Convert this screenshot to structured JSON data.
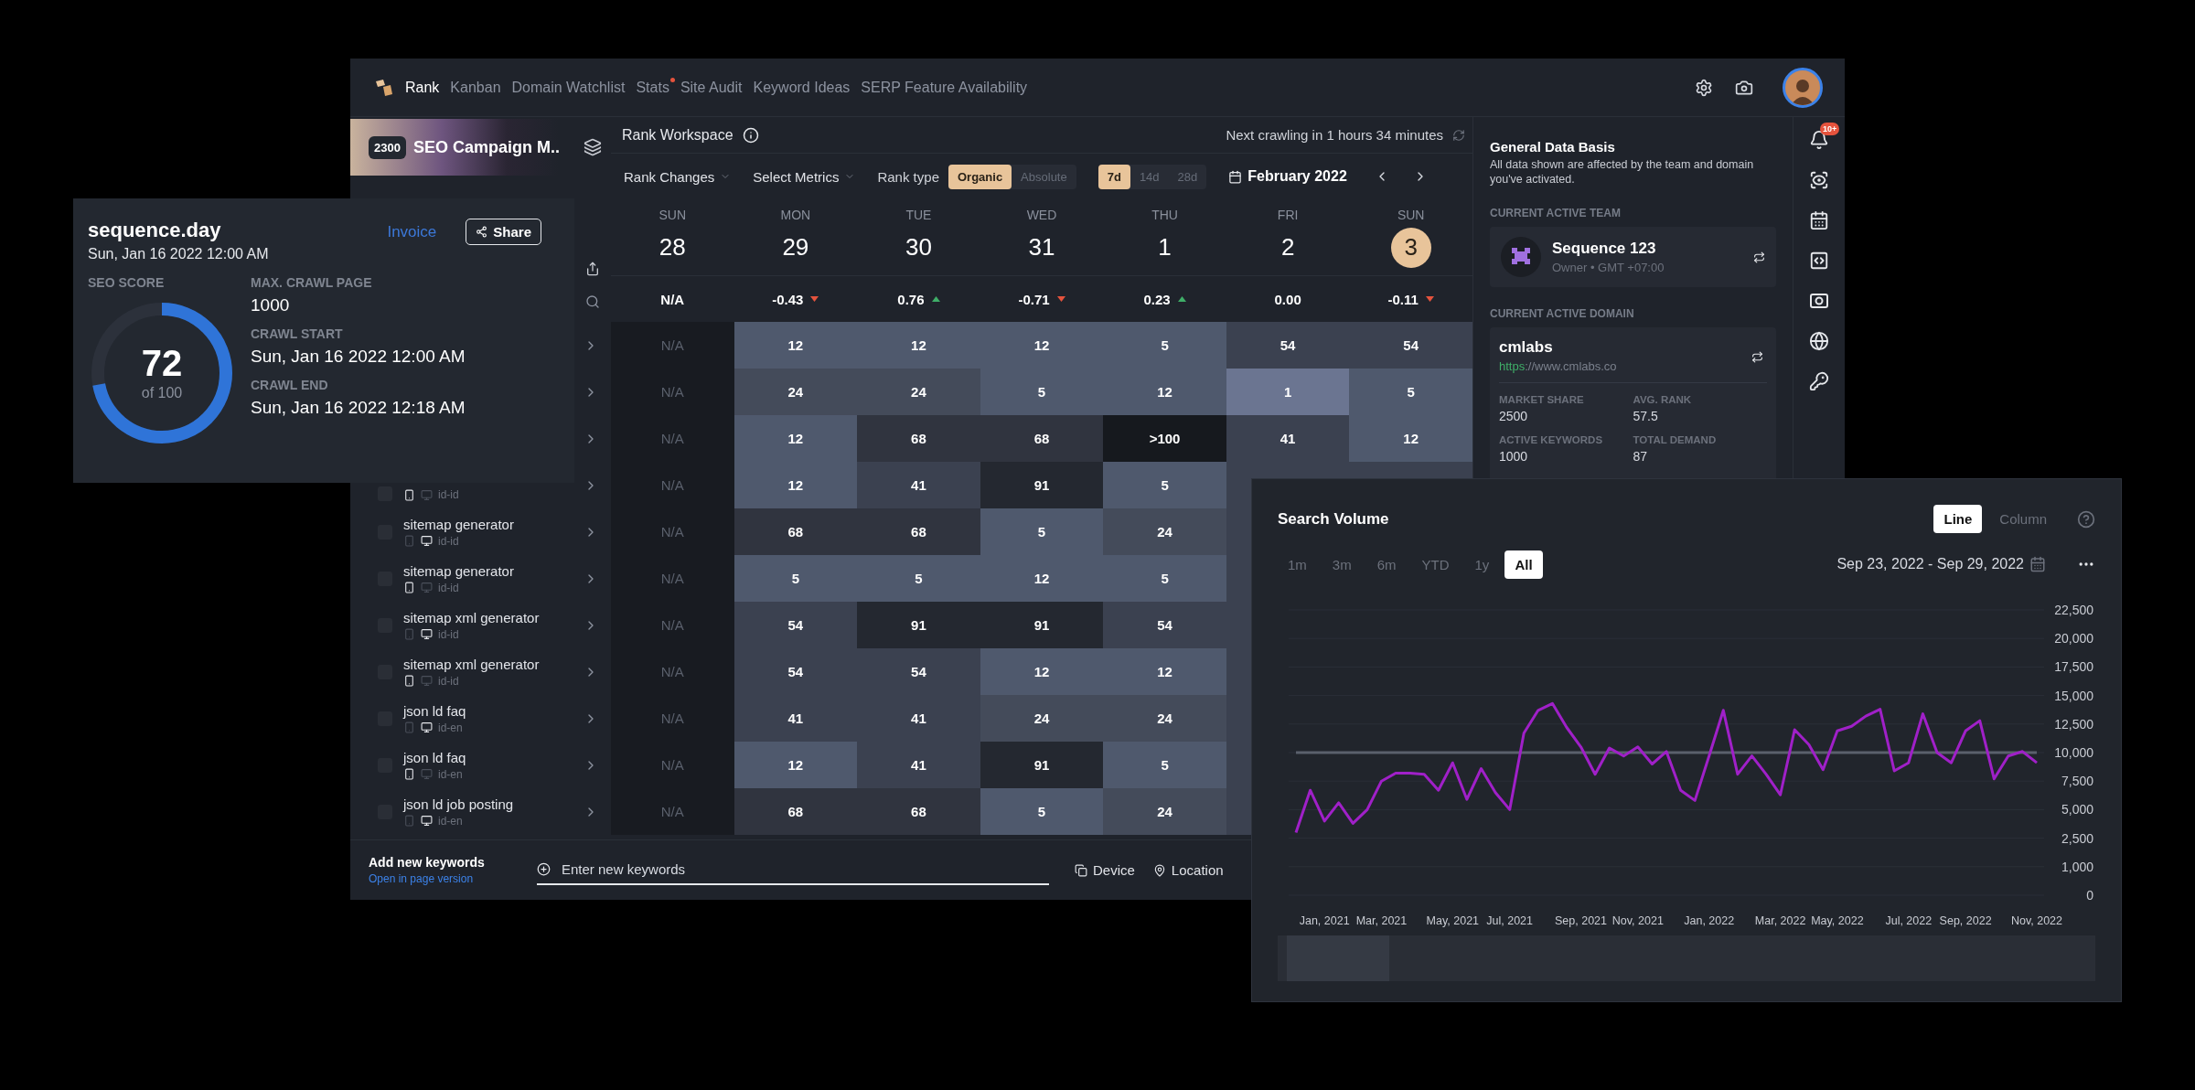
{
  "nav": {
    "items": [
      {
        "label": "Rank",
        "selected": true,
        "dot": false
      },
      {
        "label": "Kanban",
        "selected": false,
        "dot": false
      },
      {
        "label": "Domain Watchlist",
        "selected": false,
        "dot": false
      },
      {
        "label": "Stats",
        "selected": false,
        "dot": true
      },
      {
        "label": "Site Audit",
        "selected": false,
        "dot": false
      },
      {
        "label": "Keyword Ideas",
        "selected": false,
        "dot": false
      },
      {
        "label": "SERP Feature Availability",
        "selected": false,
        "dot": false
      }
    ]
  },
  "sidebar": {
    "count": "2300",
    "campaign": "SEO Campaign M..",
    "rows": [
      {
        "kind": "covered"
      },
      {
        "kind": "covered"
      },
      {
        "kind": "covered"
      },
      {
        "kind": "partial",
        "locale": "id-id",
        "mobile_active": true,
        "checked": false
      },
      {
        "kind": "keyword",
        "title": "sitemap generator",
        "locale": "id-id",
        "mobile_active": false,
        "checked": false
      },
      {
        "kind": "keyword",
        "title": "sitemap generator",
        "locale": "id-id",
        "mobile_active": true,
        "checked": false
      },
      {
        "kind": "keyword",
        "title": "sitemap xml generator",
        "locale": "id-id",
        "mobile_active": false,
        "checked": false
      },
      {
        "kind": "keyword",
        "title": "sitemap xml generator",
        "locale": "id-id",
        "mobile_active": true,
        "checked": false
      },
      {
        "kind": "keyword",
        "title": "json ld faq",
        "locale": "id-en",
        "mobile_active": false,
        "checked": false
      },
      {
        "kind": "keyword",
        "title": "json ld faq",
        "locale": "id-en",
        "mobile_active": true,
        "checked": false
      },
      {
        "kind": "keyword",
        "title": "json ld job posting",
        "locale": "id-en",
        "mobile_active": false,
        "checked": false
      }
    ]
  },
  "workspace": {
    "title": "Rank Workspace",
    "next_crawl": "Next crawling in 1 hours 34 minutes",
    "filters": [
      "Rank Changes",
      "Select Metrics"
    ],
    "rank_type_label": "Rank type",
    "rank_types": [
      {
        "label": "Organic",
        "selected": true
      },
      {
        "label": "Absolute",
        "selected": false
      }
    ],
    "periods": [
      {
        "label": "7d",
        "selected": true
      },
      {
        "label": "14d",
        "selected": false
      },
      {
        "label": "28d",
        "selected": false
      }
    ],
    "month": "February 2022"
  },
  "days": [
    {
      "weekday": "SUN",
      "date": "28",
      "selected": false,
      "change": "N/A",
      "kind": "flat"
    },
    {
      "weekday": "MON",
      "date": "29",
      "selected": false,
      "change": "-0.43",
      "kind": "down"
    },
    {
      "weekday": "TUE",
      "date": "30",
      "selected": false,
      "change": "0.76",
      "kind": "up"
    },
    {
      "weekday": "WED",
      "date": "31",
      "selected": false,
      "change": "-0.71",
      "kind": "down"
    },
    {
      "weekday": "THU",
      "date": "1",
      "selected": false,
      "change": "0.23",
      "kind": "up"
    },
    {
      "weekday": "FRI",
      "date": "2",
      "selected": false,
      "change": "0.00",
      "kind": "flat"
    },
    {
      "weekday": "SUN",
      "date": "3",
      "selected": true,
      "change": "-0.11",
      "kind": "down"
    }
  ],
  "grid": {
    "rows": [
      [
        {
          "value": "N/A",
          "color": "#181b21"
        },
        {
          "value": "12",
          "color": "#4f596d"
        },
        {
          "value": "12",
          "color": "#4f596d"
        },
        {
          "value": "12",
          "color": "#4f596d"
        },
        {
          "value": "5",
          "color": "#4f596d"
        },
        {
          "value": "54",
          "color": "#3b4150"
        },
        {
          "value": "54",
          "color": "#3b4150"
        }
      ],
      [
        {
          "value": "N/A",
          "color": "#181b21"
        },
        {
          "value": "24",
          "color": "#444b5a"
        },
        {
          "value": "24",
          "color": "#444b5a"
        },
        {
          "value": "5",
          "color": "#4f596d"
        },
        {
          "value": "12",
          "color": "#4f596d"
        },
        {
          "value": "1",
          "color": "#6b7591"
        },
        {
          "value": "5",
          "color": "#4f596d"
        }
      ],
      [
        {
          "value": "N/A",
          "color": "#181b21"
        },
        {
          "value": "12",
          "color": "#4f596d"
        },
        {
          "value": "68",
          "color": "#30343f"
        },
        {
          "value": "68",
          "color": "#30343f"
        },
        {
          "value": ">100",
          "color": "#16191e"
        },
        {
          "value": "41",
          "color": "#3b4150"
        },
        {
          "value": "12",
          "color": "#4f596d"
        }
      ],
      [
        {
          "value": "N/A",
          "color": "#181b21"
        },
        {
          "value": "12",
          "color": "#4f596d"
        },
        {
          "value": "41",
          "color": "#3b4150"
        },
        {
          "value": "91",
          "color": "#242830"
        },
        {
          "value": "5",
          "color": "#4f596d"
        }
      ],
      [
        {
          "value": "N/A",
          "color": "#181b21"
        },
        {
          "value": "68",
          "color": "#30343f"
        },
        {
          "value": "68",
          "color": "#30343f"
        },
        {
          "value": "5",
          "color": "#4f596d"
        },
        {
          "value": "24",
          "color": "#444b5a"
        }
      ],
      [
        {
          "value": "N/A",
          "color": "#181b21"
        },
        {
          "value": "5",
          "color": "#4f596d"
        },
        {
          "value": "5",
          "color": "#4f596d"
        },
        {
          "value": "12",
          "color": "#4f596d"
        },
        {
          "value": "5",
          "color": "#4f596d"
        }
      ],
      [
        {
          "value": "N/A",
          "color": "#181b21"
        },
        {
          "value": "54",
          "color": "#3b4150"
        },
        {
          "value": "91",
          "color": "#242830"
        },
        {
          "value": "91",
          "color": "#242830"
        },
        {
          "value": "54",
          "color": "#3b4150"
        }
      ],
      [
        {
          "value": "N/A",
          "color": "#181b21"
        },
        {
          "value": "54",
          "color": "#3b4150"
        },
        {
          "value": "54",
          "color": "#3b4150"
        },
        {
          "value": "12",
          "color": "#4f596d"
        },
        {
          "value": "12",
          "color": "#4f596d"
        }
      ],
      [
        {
          "value": "N/A",
          "color": "#181b21"
        },
        {
          "value": "41",
          "color": "#3b4150"
        },
        {
          "value": "41",
          "color": "#3b4150"
        },
        {
          "value": "24",
          "color": "#444b5a"
        },
        {
          "value": "24",
          "color": "#444b5a"
        }
      ],
      [
        {
          "value": "N/A",
          "color": "#181b21"
        },
        {
          "value": "12",
          "color": "#4f596d"
        },
        {
          "value": "41",
          "color": "#3b4150"
        },
        {
          "value": "91",
          "color": "#242830"
        },
        {
          "value": "5",
          "color": "#4f596d"
        }
      ],
      [
        {
          "value": "N/A",
          "color": "#181b21"
        },
        {
          "value": "68",
          "color": "#30343f"
        },
        {
          "value": "68",
          "color": "#30343f"
        },
        {
          "value": "5",
          "color": "#4f596d"
        },
        {
          "value": "24",
          "color": "#444b5a"
        }
      ]
    ]
  },
  "footer": {
    "title": "Add new keywords",
    "link": "Open in page version",
    "placeholder": "Enter new keywords",
    "device": "Device",
    "location": "Location"
  },
  "info": {
    "title": "General Data Basis",
    "description": "All data shown are affected by the team and domain you've activated.",
    "team_label": "CURRENT ACTIVE TEAM",
    "team_name": "Sequence 123",
    "team_meta": "Owner • GMT +07:00",
    "domain_label": "CURRENT ACTIVE DOMAIN",
    "domain_name": "cmlabs",
    "url_scheme": "https",
    "url_rest": "://www.cmlabs.co",
    "stats": [
      {
        "label": "MARKET SHARE",
        "value": "2500"
      },
      {
        "label": "AVG. RANK",
        "value": "57.5"
      },
      {
        "label": "ACTIVE KEYWORDS",
        "value": "1000"
      },
      {
        "label": "TOTAL DEMAND",
        "value": "87"
      }
    ]
  },
  "notifications": {
    "badge": "10+"
  },
  "crawl_card": {
    "site": "sequence.day",
    "date": "Sun, Jan 16 2022 12:00 AM",
    "invoice": "Invoice",
    "share": "Share",
    "score_label": "SEO SCORE",
    "score": "72",
    "score_of": "of 100",
    "level": 0.72,
    "facts": [
      {
        "label": "MAX. CRAWL PAGE",
        "value": "1000"
      },
      {
        "label": "CRAWL START",
        "value": "Sun, Jan 16 2022 12:00 AM"
      },
      {
        "label": "CRAWL END",
        "value": "Sun, Jan 16 2022 12:18 AM"
      }
    ]
  },
  "search_volume": {
    "title": "Search Volume",
    "views": [
      {
        "label": "Line",
        "selected": true
      },
      {
        "label": "Column",
        "selected": false
      }
    ],
    "ranges": [
      {
        "label": "1m",
        "selected": false
      },
      {
        "label": "3m",
        "selected": false
      },
      {
        "label": "6m",
        "selected": false
      },
      {
        "label": "YTD",
        "selected": false
      },
      {
        "label": "1y",
        "selected": false
      },
      {
        "label": "All",
        "selected": true
      }
    ],
    "date_range": "Sep 23, 2022 - Sep 29, 2022",
    "chart_data": {
      "type": "line",
      "categories": [
        null,
        null,
        "Jan, 2021",
        null,
        null,
        null,
        "Mar, 2021",
        null,
        null,
        null,
        null,
        "May, 2021",
        null,
        null,
        null,
        "Jul, 2021",
        null,
        null,
        null,
        null,
        "Sep, 2021",
        null,
        null,
        null,
        "Nov, 2021",
        null,
        null,
        null,
        null,
        "Jan, 2022",
        null,
        null,
        null,
        null,
        "Mar, 2022",
        null,
        null,
        null,
        "May, 2022",
        null,
        null,
        null,
        null,
        "Jul, 2022",
        null,
        null,
        null,
        "Sep, 2022",
        null,
        null,
        null,
        null,
        "Nov, 2022"
      ],
      "series": [
        {
          "color": "#5a606c",
          "values": [
            10000,
            10000,
            10000,
            10000,
            10000,
            10000,
            10000,
            10000,
            10000,
            10000,
            10000,
            10000,
            10000,
            10000,
            10000,
            10000,
            10000,
            10000,
            10000,
            10000,
            10000,
            10000,
            10000,
            10000,
            10000,
            10000,
            10000,
            10000,
            10000,
            10000,
            10000,
            10000,
            10000,
            10000,
            10000,
            10000,
            10000,
            10000,
            10000,
            10000,
            10000,
            10000,
            10000,
            10000,
            10000,
            10000,
            10000,
            10000,
            10000,
            10000,
            10000,
            10000,
            10000
          ]
        },
        {
          "color": "#a020c8",
          "values": [
            3000,
            6700,
            4000,
            5600,
            3800,
            5000,
            7500,
            8200,
            8200,
            8100,
            6700,
            9100,
            5900,
            8600,
            6500,
            5000,
            11700,
            13700,
            14300,
            12200,
            10500,
            8100,
            10400,
            9700,
            10500,
            9000,
            10100,
            6700,
            5800,
            9700,
            13700,
            8100,
            9700,
            8100,
            6300,
            12000,
            10700,
            8500,
            11900,
            12300,
            13200,
            13800,
            8400,
            9100,
            13400,
            10000,
            9100,
            11900,
            12800,
            7700,
            9700,
            10100,
            9100
          ]
        }
      ],
      "ylim": [
        2500,
        22500
      ],
      "yticks": [
        {
          "value": 2500,
          "label": "2,500"
        },
        {
          "value": 5000,
          "label": "5,000"
        },
        {
          "value": 7500,
          "label": "7,500"
        },
        {
          "value": 10000,
          "label": "10,000"
        },
        {
          "value": 12500,
          "label": "12,500"
        },
        {
          "value": 15000,
          "label": "15,000"
        },
        {
          "value": 17500,
          "label": "17,500"
        },
        {
          "value": 20000,
          "label": "20,000"
        },
        {
          "value": 22500,
          "label": "22,500"
        }
      ],
      "grid": true
    },
    "lower_axis_labels": [
      "1,000",
      "0"
    ]
  }
}
